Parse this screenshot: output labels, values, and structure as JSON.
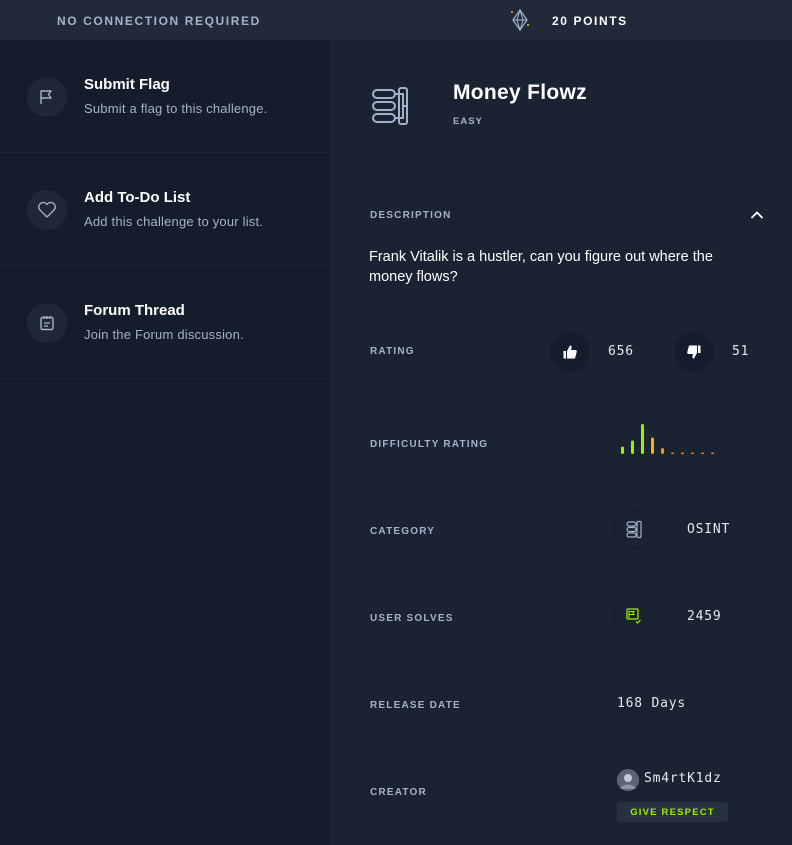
{
  "topbar": {
    "connection": "NO CONNECTION REQUIRED",
    "points": "20 POINTS",
    "points_icon": "diamond-icon"
  },
  "actions": [
    {
      "icon": "flag-icon",
      "title": "Submit Flag",
      "subtitle": "Submit a flag to this challenge."
    },
    {
      "icon": "heart-icon",
      "title": "Add To-Do List",
      "subtitle": "Add this challenge to your list."
    },
    {
      "icon": "notepad-icon",
      "title": "Forum Thread",
      "subtitle": "Join the Forum discussion."
    }
  ],
  "challenge": {
    "name": "Money Flowz",
    "difficulty": "EASY",
    "icon": "osint-stack-icon"
  },
  "description": {
    "label": "DESCRIPTION",
    "text": "Frank Vitalik is a hustler, can you figure out where the money flows?",
    "toggle_icon": "chevron-up-icon"
  },
  "rating": {
    "label": "RATING",
    "likes": "656",
    "dislikes": "51"
  },
  "difficulty_rating": {
    "label": "DIFFICULTY RATING",
    "bars": [
      {
        "level": 0.25,
        "color": "#9fef00"
      },
      {
        "level": 0.45,
        "color": "#9fef00"
      },
      {
        "level": 1.0,
        "color": "#9fef00"
      },
      {
        "level": 0.55,
        "color": "#ffaf00"
      },
      {
        "level": 0.2,
        "color": "#ff8c1a"
      },
      {
        "level": 0.05,
        "color": "#ff8c1a"
      },
      {
        "level": 0.05,
        "color": "#ff8c1a"
      },
      {
        "level": 0.05,
        "color": "#ff8c1a"
      },
      {
        "level": 0.05,
        "color": "#ff8c1a"
      },
      {
        "level": 0.05,
        "color": "#ff8c1a"
      }
    ]
  },
  "category": {
    "label": "CATEGORY",
    "value": "OSINT"
  },
  "user_solves": {
    "label": "USER SOLVES",
    "value": "2459"
  },
  "release_date": {
    "label": "RELEASE DATE",
    "value": "168 Days"
  },
  "creator": {
    "label": "CREATOR",
    "name": "Sm4rtK1dz",
    "respect_label": "GIVE RESPECT"
  },
  "colors": {
    "accent_green": "#9fef00",
    "bg_left": "#141d2b",
    "bg_right": "#1a2332",
    "text_muted": "#a4b1cd"
  }
}
